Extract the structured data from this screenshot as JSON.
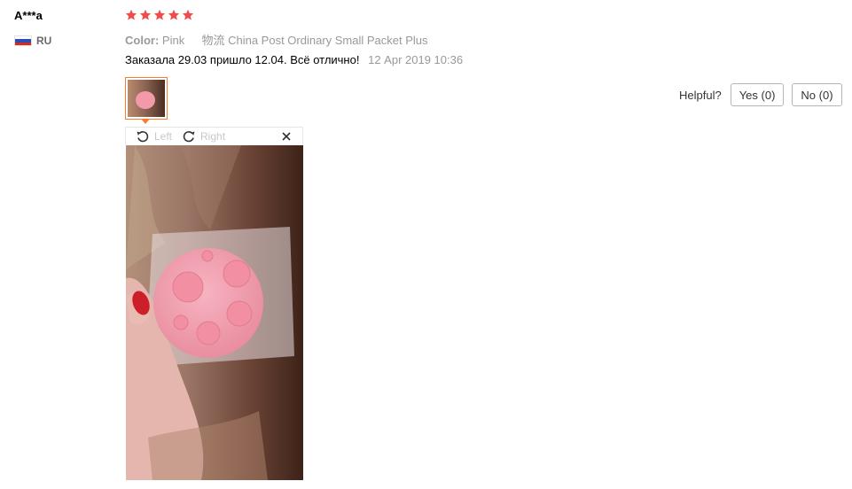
{
  "review": {
    "user_name": "A***a",
    "country_code": "RU",
    "flag_colors": [
      "#ffffff",
      "#2a4fb3",
      "#d52b1e"
    ],
    "rating": 5,
    "star_color": "#f44a4a",
    "attributes": [
      {
        "key": "Color:",
        "value": "Pink"
      },
      {
        "key": "物流",
        "value": "China Post Ordinary Small Packet Plus"
      }
    ],
    "comment": "Заказала 29.03 пришло 12.04. Всё отлично!",
    "date": "12 Apr 2019 10:36"
  },
  "image_viewer": {
    "rotate_left_label": "Left",
    "rotate_right_label": "Right",
    "close_icon": "close-icon",
    "accent_color": "#ff7a2c"
  },
  "helpful": {
    "label": "Helpful?",
    "yes_label": "Yes (0)",
    "no_label": "No (0)"
  }
}
